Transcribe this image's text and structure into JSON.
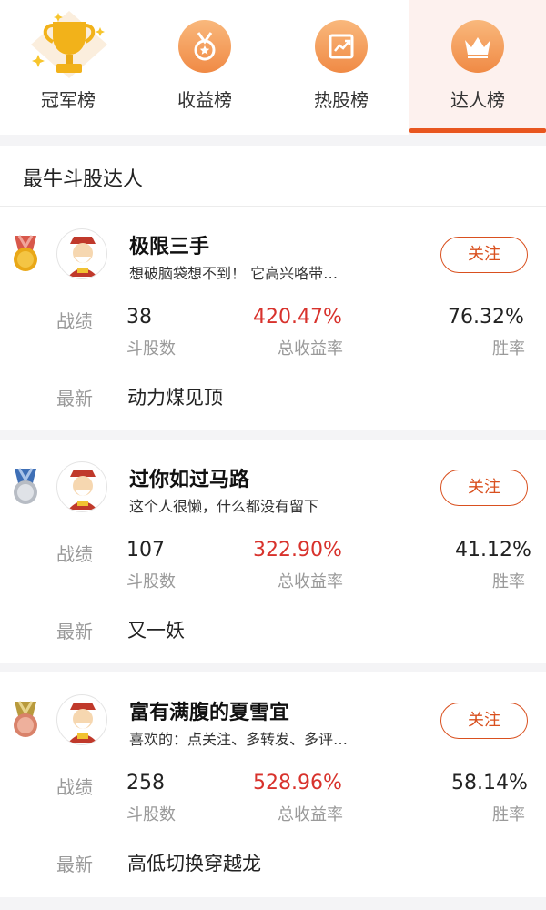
{
  "tabs": [
    {
      "label": "冠军榜",
      "icon": "trophy-icon",
      "active": false
    },
    {
      "label": "收益榜",
      "icon": "medal-icon",
      "active": false
    },
    {
      "label": "热股榜",
      "icon": "chart-icon",
      "active": false
    },
    {
      "label": "达人榜",
      "icon": "crown-icon",
      "active": true
    }
  ],
  "section_title": "最牛斗股达人",
  "labels": {
    "record": "战绩",
    "stocks": "斗股数",
    "return_rate": "总收益率",
    "win_rate": "胜率",
    "latest": "最新",
    "follow": "关注"
  },
  "experts": [
    {
      "rank": 1,
      "medal": "gold-medal-icon",
      "name": "极限三手",
      "bio": "想破脑袋想不到！ 它高兴咯带…",
      "stocks": "38",
      "return_rate": "420.47%",
      "win_rate": "76.32%",
      "latest": "动力煤见顶"
    },
    {
      "rank": 2,
      "medal": "silver-medal-icon",
      "name": "过你如过马路",
      "bio": "这个人很懒，什么都没有留下",
      "stocks": "107",
      "return_rate": "322.90%",
      "win_rate": "41.12%",
      "latest": "又一妖"
    },
    {
      "rank": 3,
      "medal": "bronze-medal-icon",
      "name": "富有满腹的夏雪宜",
      "bio": "喜欢的：点关注、多转发、多评…",
      "stocks": "258",
      "return_rate": "528.96%",
      "win_rate": "58.14%",
      "latest": "高低切换穿越龙"
    }
  ],
  "colors": {
    "accent": "#e8561f",
    "return_red": "#d8322c",
    "gold": "#e9a817",
    "silver": "#c7ccd3",
    "bronze": "#e39a7c"
  }
}
